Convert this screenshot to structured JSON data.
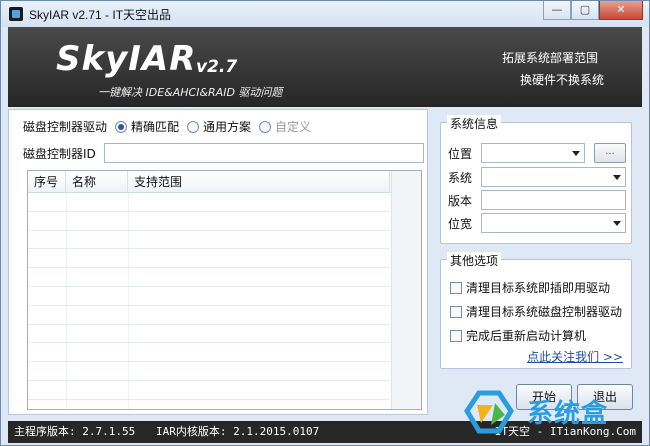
{
  "window": {
    "title": "SkyIAR v2.71 - IT天空出品"
  },
  "banner": {
    "brand": "SkyIAR",
    "version": "v2.7",
    "subtitle": "一键解决 IDE&AHCI&RAID 驱动问题",
    "link_deploy": "拓展系统部署范围",
    "link_hardware": "换硬件不换系统"
  },
  "driver": {
    "label": "磁盘控制器驱动",
    "options": [
      "精确匹配",
      "通用方案",
      "自定义"
    ],
    "selected": "精确匹配",
    "id_label": "磁盘控制器ID",
    "id_value": ""
  },
  "list": {
    "columns": [
      "序号",
      "名称",
      "支持范围"
    ],
    "rows": []
  },
  "sysinfo": {
    "title": "系统信息",
    "location_label": "位置",
    "browse_label": "...",
    "system_label": "系统",
    "version_label": "版本",
    "bits_label": "位宽"
  },
  "options": {
    "title": "其他选项",
    "items": [
      "清理目标系统即插即用驱动",
      "清理目标系统磁盘控制器驱动",
      "完成后重新启动计算机"
    ],
    "follow_link": "点此关注我们 >>"
  },
  "actions": {
    "start": "开始",
    "exit": "退出"
  },
  "status": {
    "main_version": "主程序版本: 2.7.1.55",
    "kernel_version": "IAR内核版本: 2.1.2015.0107",
    "site": "IT天空 - ITianKong.Com"
  },
  "watermark": {
    "text": "系统盒"
  },
  "colors": {
    "banner": "#262626",
    "window_bg": "#dfe9f5",
    "link": "#1f4f9c",
    "watermark": "#2a9de0"
  }
}
